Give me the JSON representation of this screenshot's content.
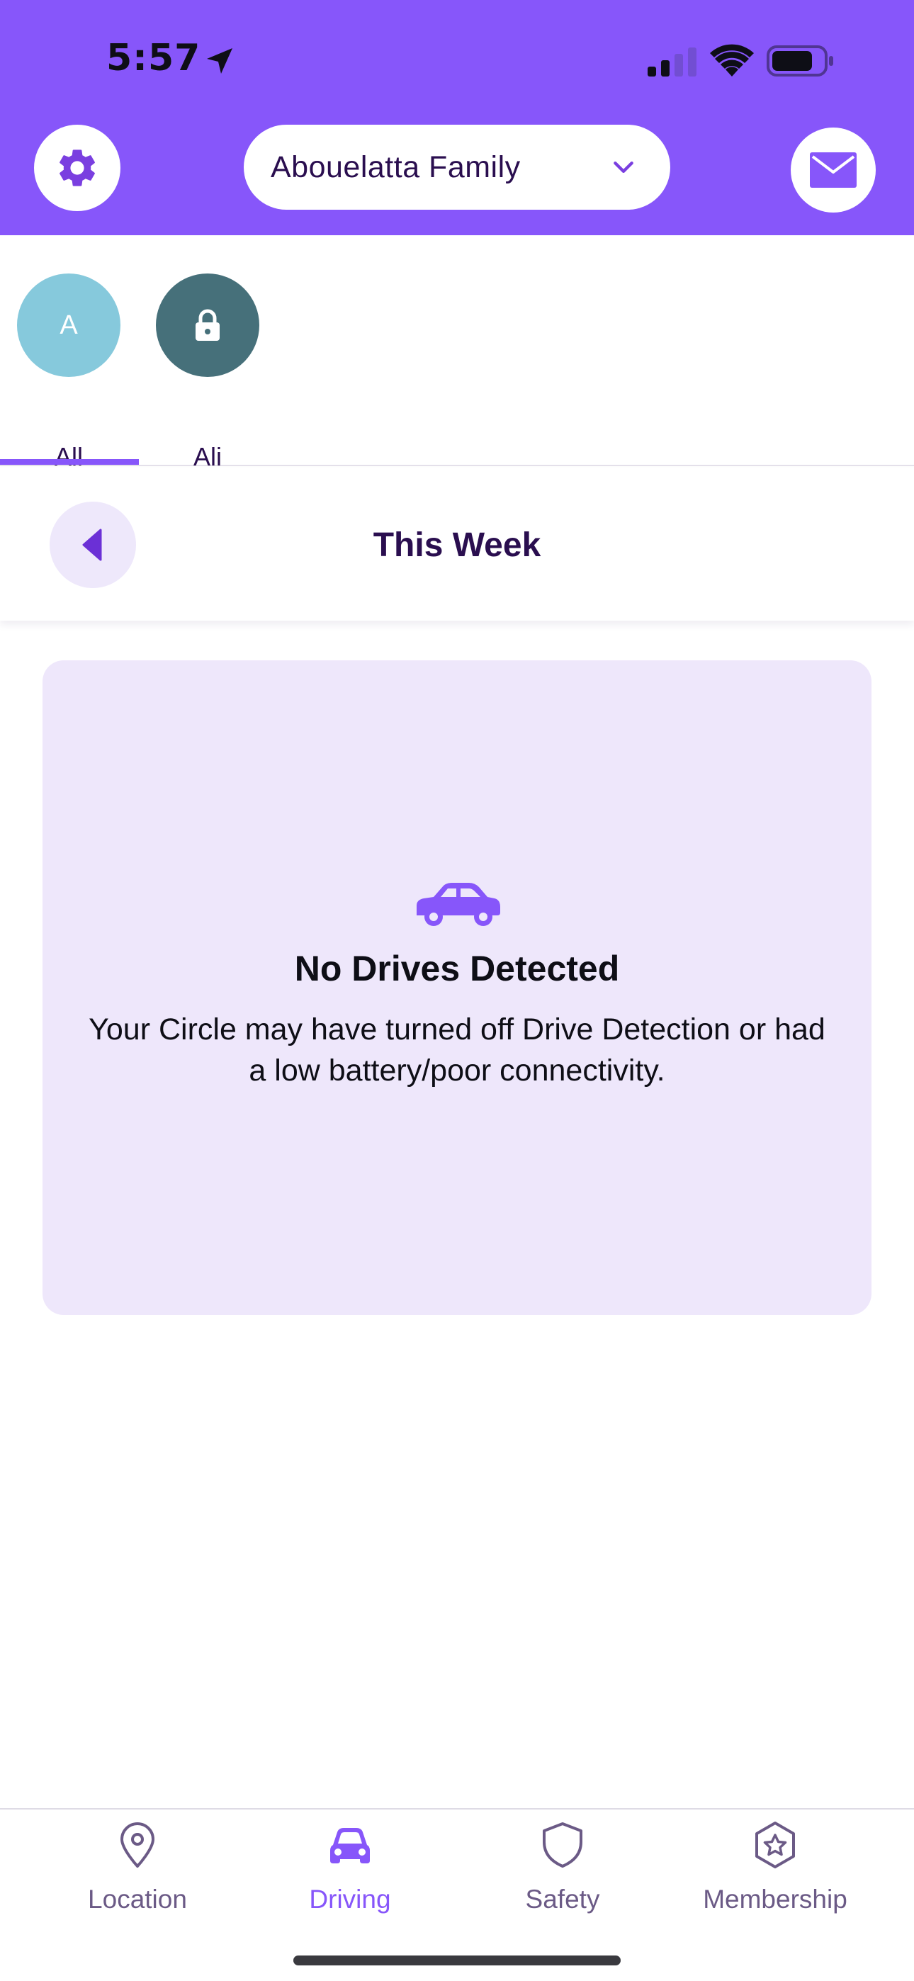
{
  "status_bar": {
    "time": "5:57"
  },
  "header": {
    "circle_name": "Abouelatta Family",
    "icons": {
      "settings": "gear-icon",
      "messages": "envelope-icon",
      "selector": "chevron-down-icon"
    }
  },
  "members": [
    {
      "initial": "A",
      "name": "All",
      "selected": true
    },
    {
      "name": "Ali",
      "icon": "lock-icon",
      "selected": false
    }
  ],
  "week_bar": {
    "title": "This Week"
  },
  "empty_state": {
    "icon": "car-icon",
    "title": "No Drives Detected",
    "body": "Your Circle may have turned off Drive Detection or had a low battery/poor connectivity."
  },
  "tabs": [
    {
      "label": "Location",
      "icon": "location-pin-icon",
      "active": false
    },
    {
      "label": "Driving",
      "icon": "car-icon",
      "active": true
    },
    {
      "label": "Safety",
      "icon": "shield-icon",
      "active": false
    },
    {
      "label": "Membership",
      "icon": "star-badge-icon",
      "active": false
    }
  ],
  "colors": {
    "brand_purple": "#8756fa",
    "dark_text": "#2a0e4f",
    "card_background": "#eee7fb",
    "avatar_all": "#86c9dc",
    "avatar_ali": "#46707a"
  }
}
